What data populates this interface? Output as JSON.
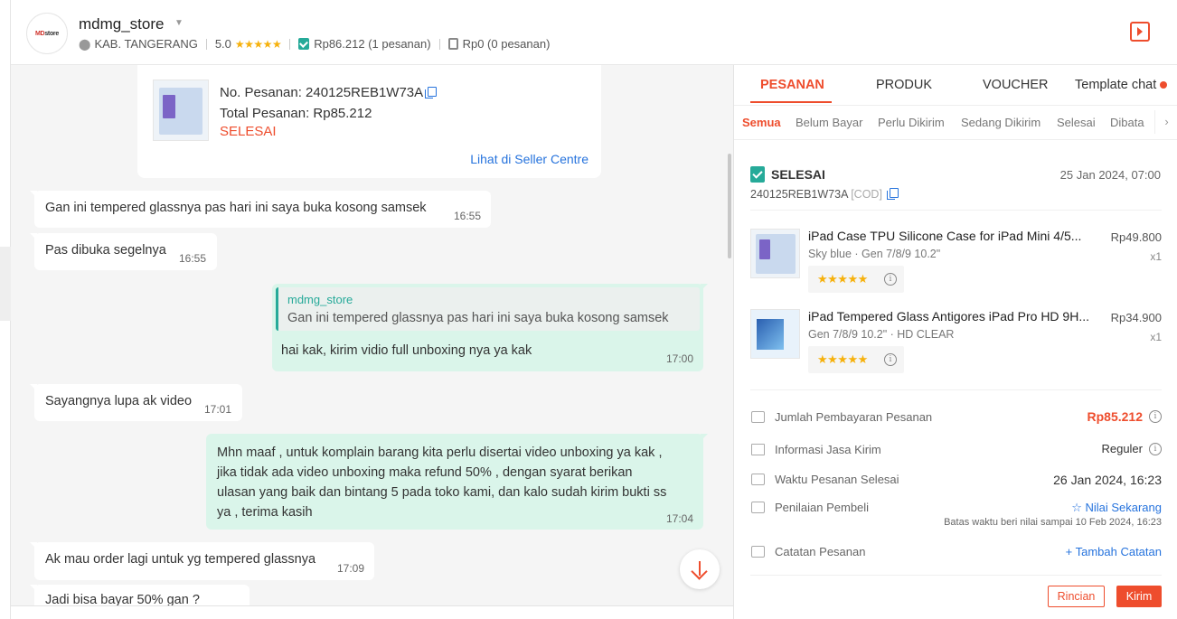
{
  "header": {
    "avatar_logo_a": "MD",
    "avatar_logo_b": "store",
    "store_name": "mdmg_store",
    "location": "KAB. TANGERANG",
    "rating": "5.0",
    "paid_orders": "Rp86.212 (1 pesanan)",
    "unpaid_orders": "Rp0 (0 pesanan)"
  },
  "chat": {
    "order_card": {
      "order_no": "No. Pesanan: 240125REB1W73A",
      "total": "Total Pesanan: Rp85.212",
      "status": "SELESAI",
      "link": "Lihat di Seller Centre"
    },
    "messages": [
      {
        "text": "Gan ini tempered glassnya pas hari ini saya buka kosong samsek",
        "time": "16:55"
      },
      {
        "text": "Pas dibuka segelnya",
        "time": "16:55"
      },
      {
        "quote_name": "mdmg_store",
        "quote_text": "Gan ini tempered glassnya pas hari ini saya buka kosong samsek",
        "text": "hai kak,  kirim vidio full unboxing nya ya kak",
        "time": "17:00"
      },
      {
        "text": "Sayangnya lupa ak video",
        "time": "17:01"
      },
      {
        "lines": [
          "Mhn maaf , untuk komplain barang kita perlu disertai video unboxing ya kak ,",
          "jika tidak ada video unboxing maka refund 50% , dengan syarat berikan",
          "ulasan yang baik dan bintang 5 pada toko kami, dan kalo sudah kirim bukti ss",
          "ya , terima kasih"
        ],
        "time": "17:04"
      },
      {
        "text": "Ak mau order lagi untuk yg tempered glassnya",
        "time": "17:09"
      },
      {
        "text": "Jadi bisa bayar 50% gan ?"
      }
    ]
  },
  "panel": {
    "tabs": [
      "PESANAN",
      "PRODUK",
      "VOUCHER",
      "Template chat"
    ],
    "subtabs": [
      "Semua",
      "Belum Bayar",
      "Perlu Dikirim",
      "Sedang Dikirim",
      "Selesai",
      "Dibata"
    ],
    "status": "SELESAI",
    "date": "25 Jan 2024, 07:00",
    "order_id": "240125REB1W73A",
    "cod": "[COD]",
    "items": [
      {
        "name": "iPad Case TPU Silicone Case for iPad Mini 4/5...",
        "variant": "Sky blue · Gen 7/8/9 10.2\"",
        "price": "Rp49.800",
        "qty": "x1",
        "rating": 5
      },
      {
        "name": "iPad Tempered Glass Antigores iPad Pro HD 9H...",
        "variant": "Gen 7/8/9 10.2\" · HD CLEAR",
        "price": "Rp34.900",
        "qty": "x1",
        "rating": 5
      }
    ],
    "info": {
      "payment_label": "Jumlah Pembayaran Pesanan",
      "payment_value": "Rp85.212",
      "shipping_label": "Informasi Jasa Kirim",
      "shipping_value": "Reguler",
      "completed_label": "Waktu Pesanan Selesai",
      "completed_value": "26 Jan 2024, 16:23",
      "review_label": "Penilaian Pembeli",
      "review_value": "☆ Nilai Sekarang",
      "review_deadline": "Batas waktu beri nilai sampai 10 Feb 2024, 16:23",
      "notes_label": "Catatan Pesanan",
      "notes_value": "+ Tambah Catatan"
    },
    "buttons": {
      "details": "Rincian",
      "send": "Kirim"
    }
  },
  "colors": {
    "accent": "#ee4d2d",
    "success": "#26aa99",
    "link": "#2673dd",
    "star": "#f6b10c"
  }
}
